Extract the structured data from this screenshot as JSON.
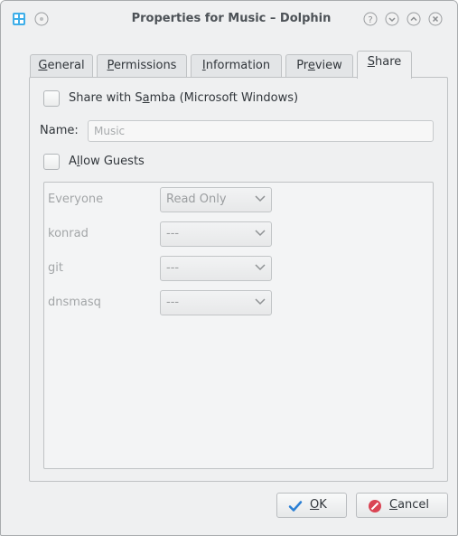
{
  "window": {
    "title": "Properties for Music – Dolphin"
  },
  "tabs": [
    {
      "label": "General",
      "mnemonic": "G",
      "rest": "eneral"
    },
    {
      "label": "Permissions",
      "mnemonic": "P",
      "rest": "ermissions"
    },
    {
      "label": "Information",
      "mnemonic": "I",
      "rest": "nformation"
    },
    {
      "label": "Preview",
      "pre": "Pr",
      "mnemonic": "e",
      "rest": "view"
    },
    {
      "label": "Share",
      "mnemonic": "S",
      "rest": "hare",
      "active": true
    }
  ],
  "share": {
    "samba_label_pre": "Share with S",
    "samba_label_mn": "a",
    "samba_label_post": "mba (Microsoft Windows)",
    "samba_checked": false,
    "name_label": "Name:",
    "name_value": "Music",
    "guests_label_pre": "A",
    "guests_label_mn": "l",
    "guests_label_post": "low Guests",
    "guests_checked": false
  },
  "permissions": [
    {
      "user": "Everyone",
      "access": "Read Only"
    },
    {
      "user": "konrad",
      "access": "---"
    },
    {
      "user": "git",
      "access": "---"
    },
    {
      "user": "dnsmasq",
      "access": "---"
    }
  ],
  "buttons": {
    "ok_mn": "O",
    "ok_rest": "K",
    "cancel_mn": "C",
    "cancel_rest": "ancel"
  },
  "colors": {
    "ok_icon": "#2a7fd4",
    "cancel_icon": "#da4453"
  }
}
